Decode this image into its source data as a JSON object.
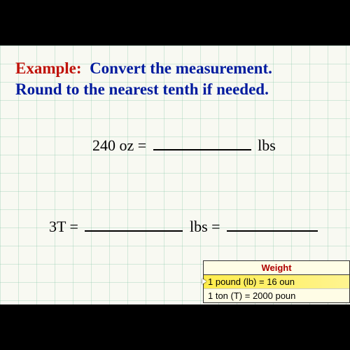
{
  "header": {
    "example_label": "Example:",
    "instruction_line1": "Convert the measurement.",
    "instruction_line2": "Round to the nearest tenth if needed."
  },
  "problem1": {
    "lhs": "240 oz =",
    "rhs_unit": "lbs"
  },
  "problem2": {
    "lhs": "3T =",
    "mid_unit": "lbs ="
  },
  "weight_box": {
    "title": "Weight",
    "row1": "1 pound (lb) = 16 oun",
    "row2": "1 ton (T) = 2000 poun"
  }
}
